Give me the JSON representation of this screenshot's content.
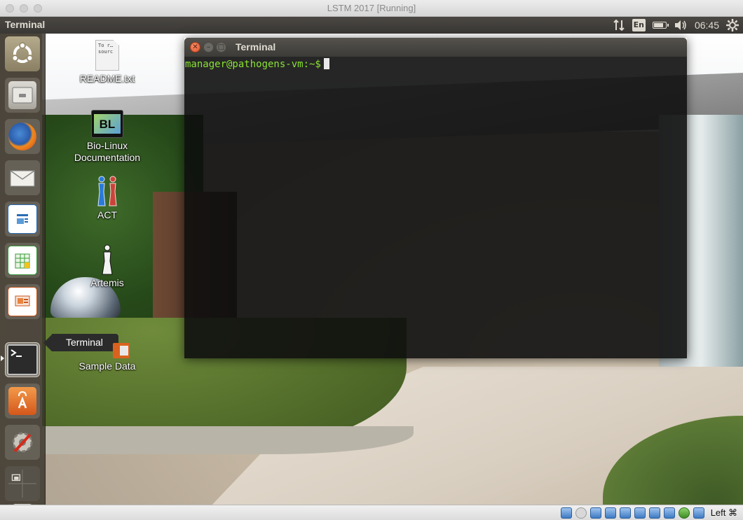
{
  "host_window": {
    "title": "LSTM 2017 [Running]"
  },
  "topbar": {
    "app_name": "Terminal",
    "keyboard_layout": "En",
    "clock": "06:45",
    "icons": [
      "network-updown-icon",
      "keyboard-layout-icon",
      "battery-icon",
      "volume-icon",
      "settings-gear-icon"
    ]
  },
  "launcher": {
    "items": [
      {
        "name": "dash-home",
        "icon": "ubuntu-logo-icon"
      },
      {
        "name": "files",
        "icon": "file-cabinet-icon"
      },
      {
        "name": "firefox",
        "icon": "firefox-icon"
      },
      {
        "name": "mail",
        "icon": "envelope-icon"
      },
      {
        "name": "writer",
        "icon": "writer-document-icon"
      },
      {
        "name": "calc",
        "icon": "spreadsheet-icon"
      },
      {
        "name": "impress",
        "icon": "presentation-icon"
      },
      {
        "name": "terminal",
        "icon": "terminal-icon",
        "active": true
      },
      {
        "name": "software-center",
        "icon": "shopping-bag-icon"
      },
      {
        "name": "system-settings",
        "icon": "settings-wrench-icon"
      },
      {
        "name": "workspace-switcher",
        "icon": "workspaces-icon"
      },
      {
        "name": "trash",
        "icon": "trash-icon"
      }
    ],
    "tooltip": "Terminal"
  },
  "desktop_icons": [
    {
      "label": "README.txt",
      "icon": "text-file-icon",
      "file_preview": "To r…\nsourc"
    },
    {
      "label": "Bio-Linux Documentation",
      "icon": "bio-linux-icon",
      "badge": "BL"
    },
    {
      "label": "ACT",
      "icon": "act-figures-icon"
    },
    {
      "label": "Artemis",
      "icon": "artemis-figure-icon"
    },
    {
      "label": "Sample Data",
      "icon": "folder-icon"
    }
  ],
  "terminal": {
    "title": "Terminal",
    "prompt": "manager@pathogens-vm:~$",
    "input": ""
  },
  "vbox_status": {
    "host_key": "Left ⌘",
    "icons": [
      "hard-disk-icon",
      "optical-drive-icon",
      "network-icon",
      "usb-icon",
      "shared-folders-icon",
      "display-icon",
      "recording-icon",
      "capture-icon",
      "video-capture-icon",
      "mouse-integration-icon"
    ]
  }
}
